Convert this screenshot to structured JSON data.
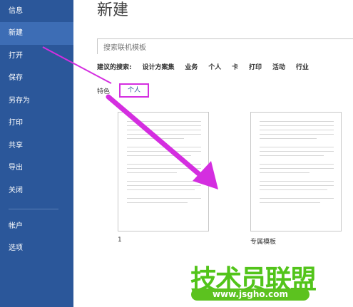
{
  "sidebar": {
    "items": [
      {
        "label": "信息"
      },
      {
        "label": "新建",
        "active": true
      },
      {
        "label": "打开"
      },
      {
        "label": "保存"
      },
      {
        "label": "另存为"
      },
      {
        "label": "打印"
      },
      {
        "label": "共享"
      },
      {
        "label": "导出"
      },
      {
        "label": "关闭"
      },
      {
        "label": "帐户"
      },
      {
        "label": "选项"
      }
    ]
  },
  "main": {
    "title": "新建",
    "search": {
      "placeholder": "搜索联机模板"
    },
    "suggested": {
      "label": "建议的搜索:",
      "links": [
        "设计方案集",
        "业务",
        "个人",
        "卡",
        "打印",
        "活动",
        "行业"
      ]
    },
    "tabs": {
      "featured": "特色",
      "personal": "个人"
    },
    "templates": [
      {
        "label": "1"
      },
      {
        "label": "专属模板"
      }
    ]
  },
  "watermark": {
    "text": "技术员联盟",
    "url": "www.jsgho.com"
  },
  "colors": {
    "sidebar": "#2b579a",
    "highlight": "#d42ee0",
    "watermark": "#52c41a"
  }
}
